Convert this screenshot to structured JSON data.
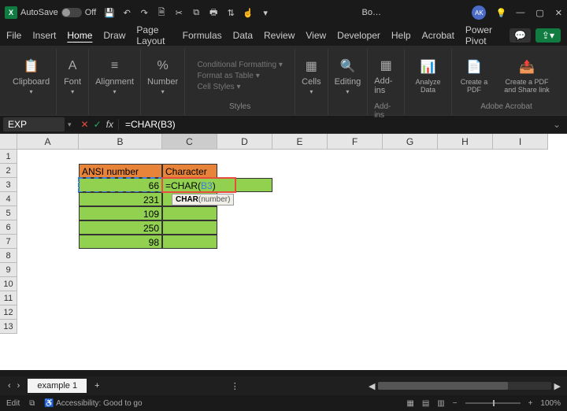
{
  "titlebar": {
    "autosave_label": "AutoSave",
    "autosave_state": "Off",
    "doc_title": "Bo…",
    "avatar": "AK"
  },
  "menu": {
    "tabs": [
      "File",
      "Insert",
      "Home",
      "Draw",
      "Page Layout",
      "Formulas",
      "Data",
      "Review",
      "View",
      "Developer",
      "Help",
      "Acrobat",
      "Power Pivot"
    ]
  },
  "ribbon": {
    "clipboard": "Clipboard",
    "font": "Font",
    "alignment": "Alignment",
    "number": "Number",
    "styles": "Styles",
    "styles_items": {
      "cond": "Conditional Formatting ▾",
      "table": "Format as Table ▾",
      "cell": "Cell Styles ▾"
    },
    "cells": "Cells",
    "editing": "Editing",
    "addins": "Add-ins",
    "analyze": "Analyze Data",
    "create_pdf": "Create a PDF",
    "create_share": "Create a PDF and Share link",
    "addins_group": "Add-ins",
    "acrobat_group": "Adobe Acrobat"
  },
  "fbar": {
    "namebox": "EXP",
    "formula": "=CHAR(B3)"
  },
  "grid": {
    "cols": [
      "A",
      "B",
      "C",
      "D",
      "E",
      "F",
      "G",
      "H",
      "I"
    ],
    "rows": [
      "1",
      "2",
      "3",
      "4",
      "5",
      "6",
      "7",
      "8",
      "9",
      "10",
      "11",
      "12",
      "13"
    ],
    "b2": "ANSI number",
    "c2": "Character",
    "b3": "66",
    "b4": "231",
    "b5": "109",
    "b6": "250",
    "b7": "98",
    "c3_formula_pre": "=CHAR(",
    "c3_formula_ref": "B3",
    "c3_formula_post": ")",
    "tooltip_fn": "CHAR",
    "tooltip_arg": "(number)"
  },
  "sheets": {
    "active": "example 1"
  },
  "status": {
    "mode": "Edit",
    "acc": "Accessibility: Good to go",
    "zoom": "100%"
  }
}
